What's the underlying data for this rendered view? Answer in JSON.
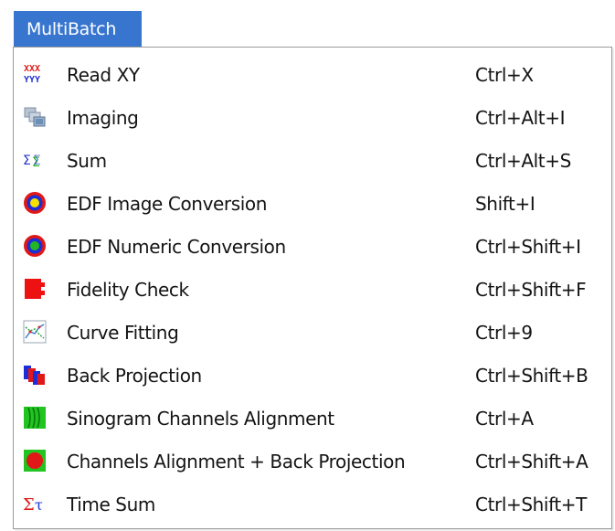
{
  "menubar": {
    "title": "MultiBatch"
  },
  "menu": {
    "items": [
      {
        "label": "Read XY",
        "shortcut": "Ctrl+X",
        "icon": "read-xy-icon"
      },
      {
        "label": "Imaging",
        "shortcut": "Ctrl+Alt+I",
        "icon": "imaging-icon"
      },
      {
        "label": "Sum",
        "shortcut": "Ctrl+Alt+S",
        "icon": "sum-icon"
      },
      {
        "label": "EDF Image Conversion",
        "shortcut": "Shift+I",
        "icon": "target-yellow-icon"
      },
      {
        "label": "EDF Numeric Conversion",
        "shortcut": "Ctrl+Shift+I",
        "icon": "target-green-icon"
      },
      {
        "label": "Fidelity Check",
        "shortcut": "Ctrl+Shift+F",
        "icon": "red-block-icon"
      },
      {
        "label": "Curve Fitting",
        "shortcut": "Ctrl+9",
        "icon": "curve-fitting-icon"
      },
      {
        "label": "Back Projection",
        "shortcut": "Ctrl+Shift+B",
        "icon": "back-projection-icon"
      },
      {
        "label": "Sinogram Channels Alignment",
        "shortcut": "Ctrl+A",
        "icon": "sinogram-icon"
      },
      {
        "label": "Channels Alignment + Back Projection",
        "shortcut": "Ctrl+Shift+A",
        "icon": "channels-backprojection-icon"
      },
      {
        "label": "Time Sum",
        "shortcut": "Ctrl+Shift+T",
        "icon": "time-sum-icon"
      }
    ]
  },
  "colors": {
    "menubar_accent": "#3875cf",
    "border": "#9a9a9a"
  }
}
